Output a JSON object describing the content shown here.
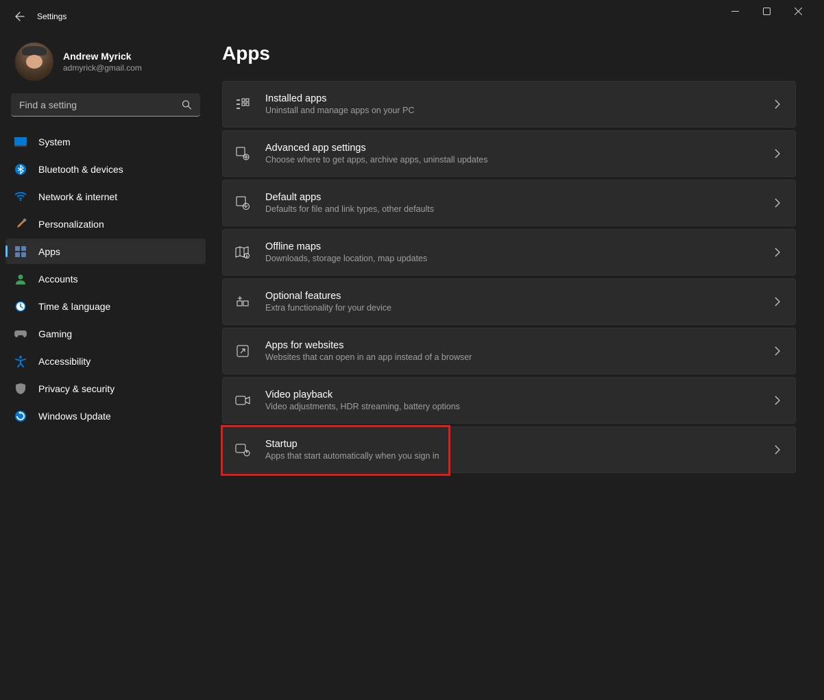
{
  "window": {
    "title": "Settings"
  },
  "user": {
    "name": "Andrew Myrick",
    "email": "admyrick@gmail.com"
  },
  "search": {
    "placeholder": "Find a setting"
  },
  "nav": {
    "items": [
      {
        "label": "System"
      },
      {
        "label": "Bluetooth & devices"
      },
      {
        "label": "Network & internet"
      },
      {
        "label": "Personalization"
      },
      {
        "label": "Apps"
      },
      {
        "label": "Accounts"
      },
      {
        "label": "Time & language"
      },
      {
        "label": "Gaming"
      },
      {
        "label": "Accessibility"
      },
      {
        "label": "Privacy & security"
      },
      {
        "label": "Windows Update"
      }
    ],
    "active_index": 4
  },
  "page": {
    "title": "Apps"
  },
  "cards": [
    {
      "title": "Installed apps",
      "sub": "Uninstall and manage apps on your PC"
    },
    {
      "title": "Advanced app settings",
      "sub": "Choose where to get apps, archive apps, uninstall updates"
    },
    {
      "title": "Default apps",
      "sub": "Defaults for file and link types, other defaults"
    },
    {
      "title": "Offline maps",
      "sub": "Downloads, storage location, map updates"
    },
    {
      "title": "Optional features",
      "sub": "Extra functionality for your device"
    },
    {
      "title": "Apps for websites",
      "sub": "Websites that can open in an app instead of a browser"
    },
    {
      "title": "Video playback",
      "sub": "Video adjustments, HDR streaming, battery options"
    },
    {
      "title": "Startup",
      "sub": "Apps that start automatically when you sign in"
    }
  ],
  "highlight_card_index": 7,
  "colors": {
    "accent": "#4cc2ff",
    "highlight_border": "#e21b1b"
  }
}
